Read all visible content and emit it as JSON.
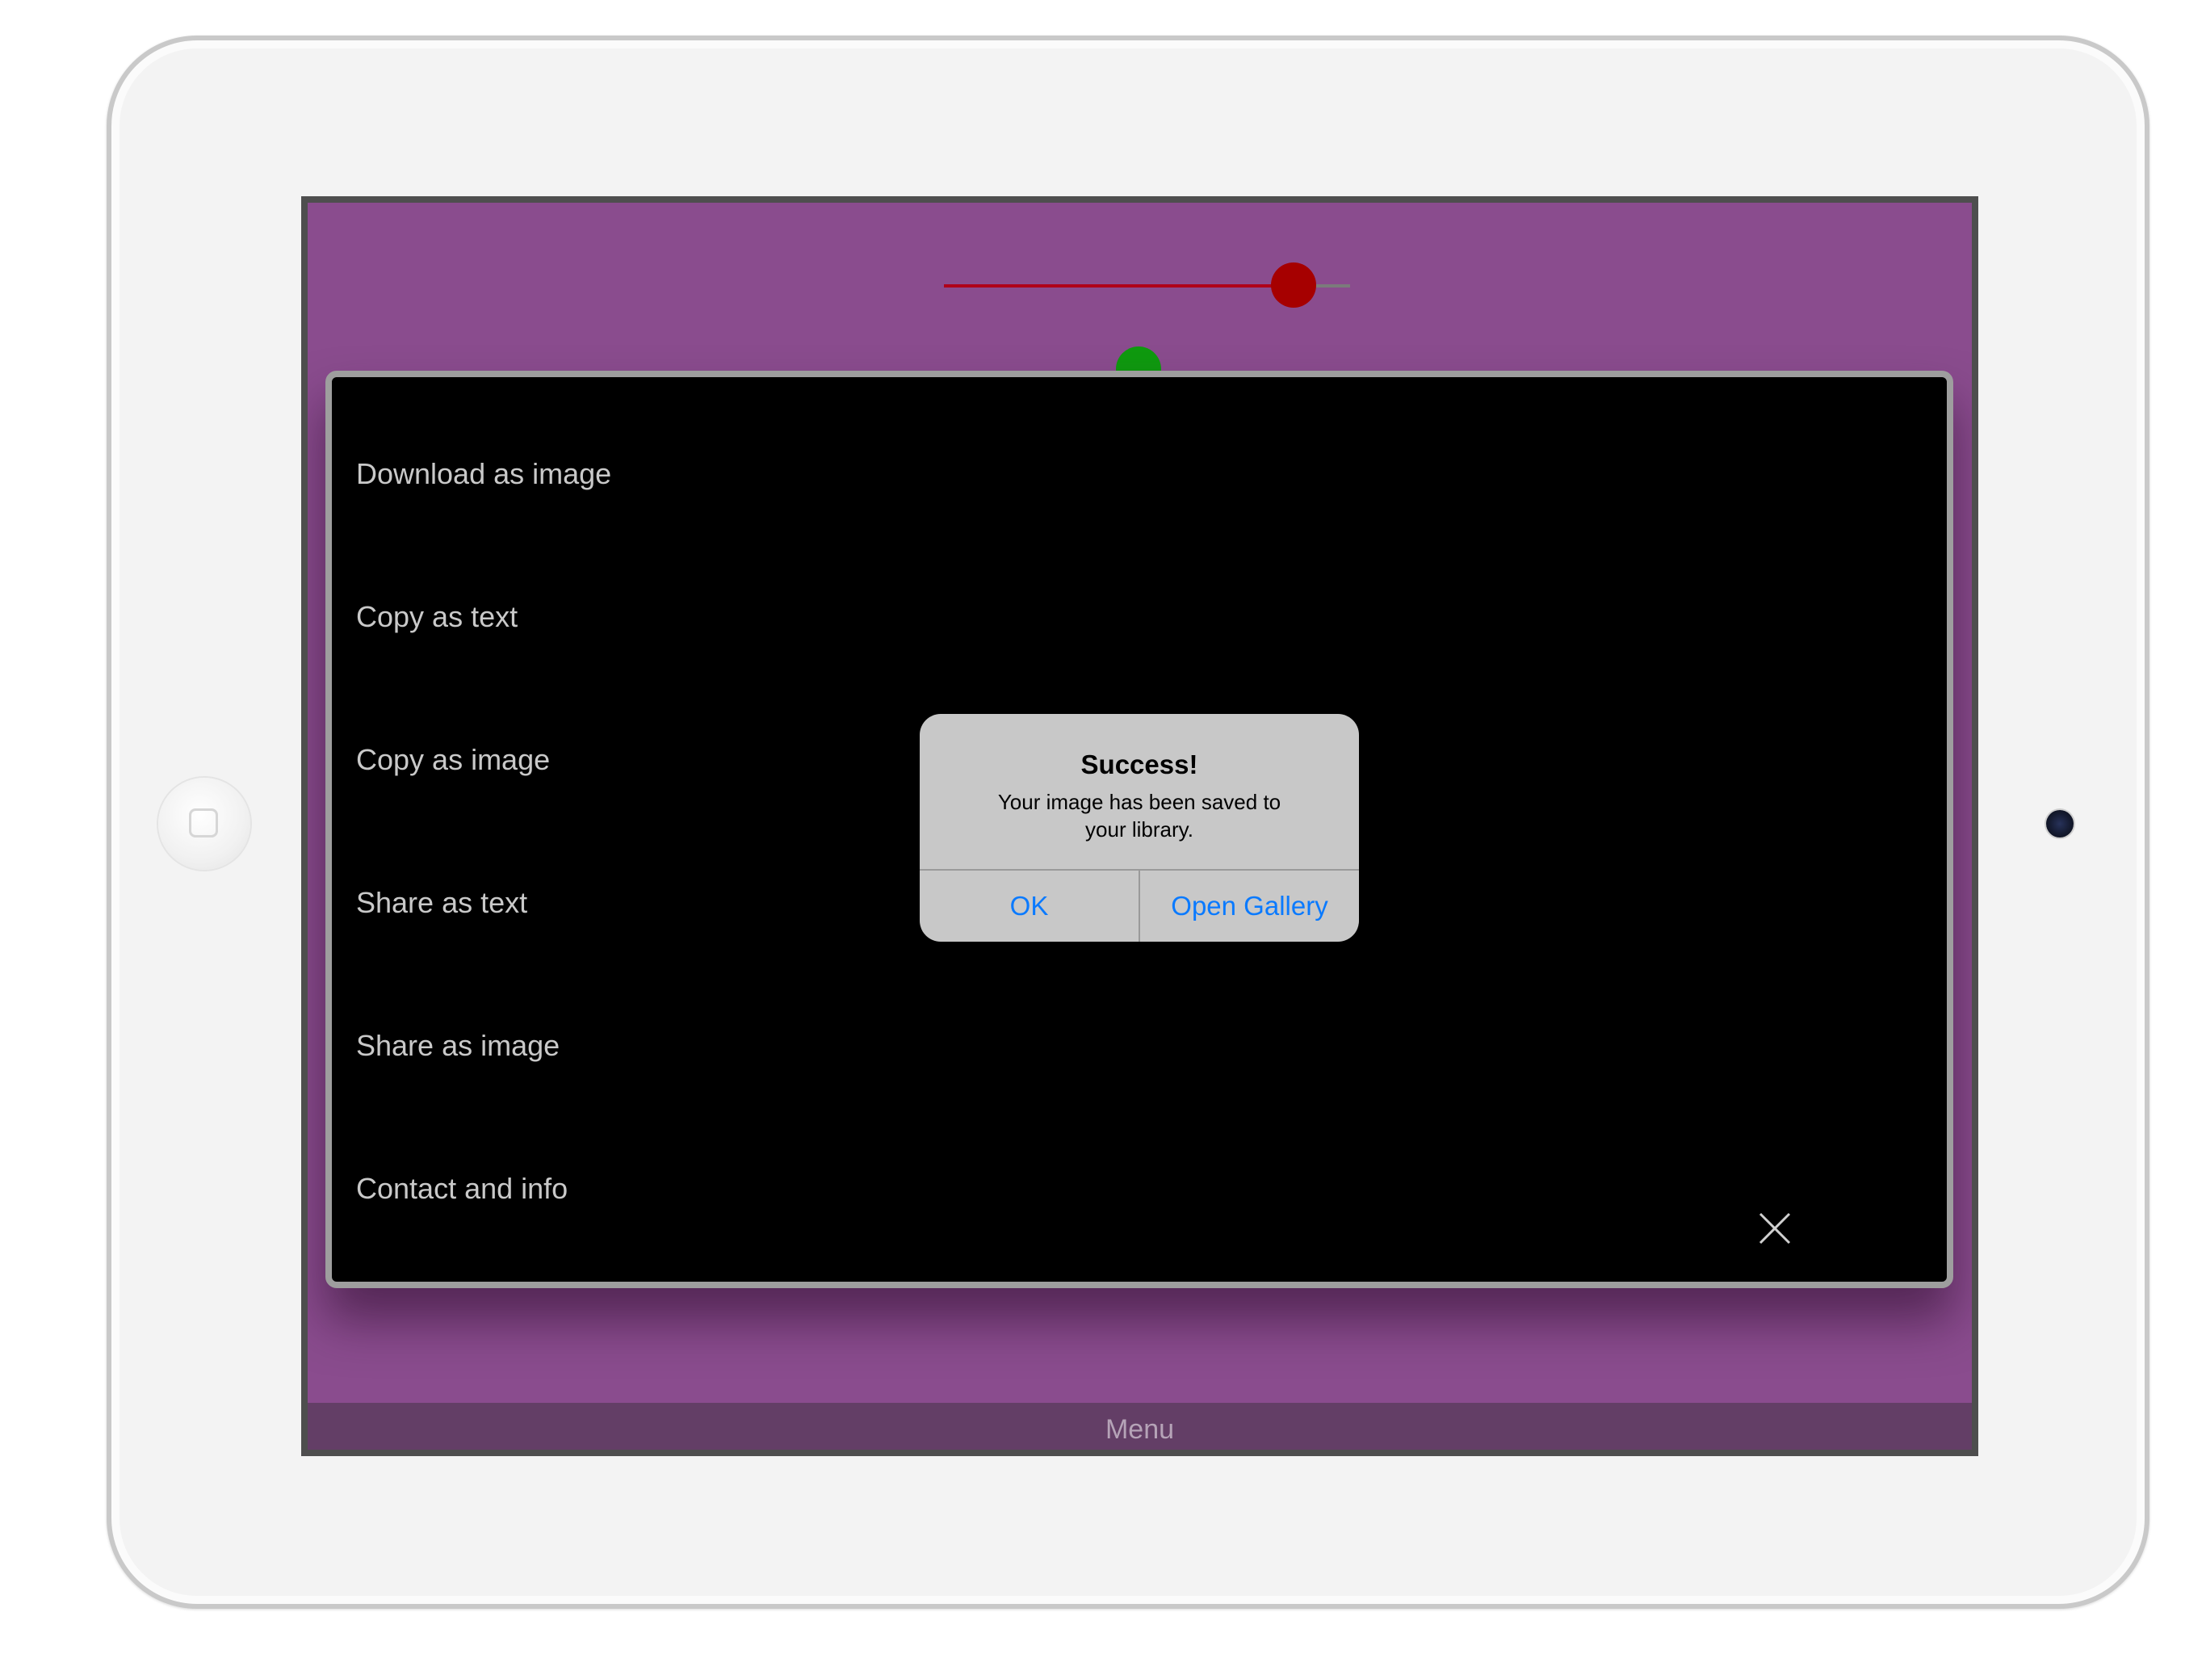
{
  "menu": {
    "items": [
      {
        "label": "Download as image"
      },
      {
        "label": "Copy as text"
      },
      {
        "label": "Copy as image"
      },
      {
        "label": "Share as text"
      },
      {
        "label": "Share as image"
      },
      {
        "label": "Contact and info"
      }
    ],
    "close_icon": "close-x-icon"
  },
  "menu_bar": {
    "label": "Menu"
  },
  "slider": {
    "value": 0.86,
    "fill_color": "#b0001a",
    "thumb_color": "#a60000"
  },
  "alert": {
    "title": "Success!",
    "message": "Your image has been saved to your library.",
    "ok_label": "OK",
    "gallery_label": "Open Gallery",
    "button_color": "#0a7aff"
  },
  "colors": {
    "background": "#8a4c8e",
    "menu_bar": "#633e66",
    "panel": "#000000"
  }
}
